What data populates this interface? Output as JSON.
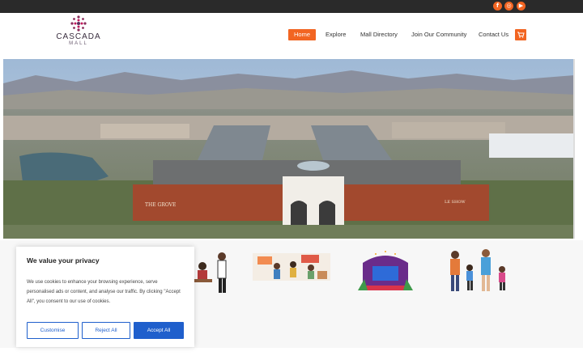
{
  "topbar": {
    "social": [
      {
        "icon": "facebook-icon",
        "glyph": "f"
      },
      {
        "icon": "instagram-icon",
        "glyph": "◎"
      },
      {
        "icon": "youtube-icon",
        "glyph": "▶"
      }
    ]
  },
  "brand": {
    "name": "CASCADA",
    "sub": "MALL"
  },
  "nav": {
    "items": [
      "Home",
      "Explore",
      "Mall Directory",
      "Join Our Community",
      "Contact Us"
    ],
    "active": "Home"
  },
  "colors": {
    "accent": "#f26522",
    "button_blue": "#1f5fcc",
    "topbar": "#2a2a2a"
  },
  "hero": {
    "sign_left": "THE GROVE",
    "sign_right": "LE SHOW"
  },
  "cookie": {
    "title": "We value your privacy",
    "text": "We use cookies to enhance your browsing experience, serve personalised ads or content, and analyse our traffic. By clicking \"Accept All\", you consent to our use of cookies.",
    "customise": "Customise",
    "reject": "Reject All",
    "accept": "Accept All"
  }
}
